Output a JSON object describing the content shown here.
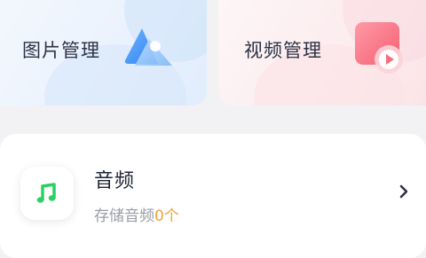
{
  "cards": {
    "images": {
      "label": "图片管理",
      "icon": "image-mountain-icon",
      "accent": "#3b8ef5"
    },
    "videos": {
      "label": "视频管理",
      "icon": "video-play-icon",
      "accent": "#f56f7e"
    }
  },
  "list": {
    "audio": {
      "title": "音频",
      "subtitle_prefix": "存储音频",
      "count": "0个",
      "icon": "music-note-icon",
      "accent": "#2bd165",
      "count_color": "#f0a23b"
    }
  }
}
